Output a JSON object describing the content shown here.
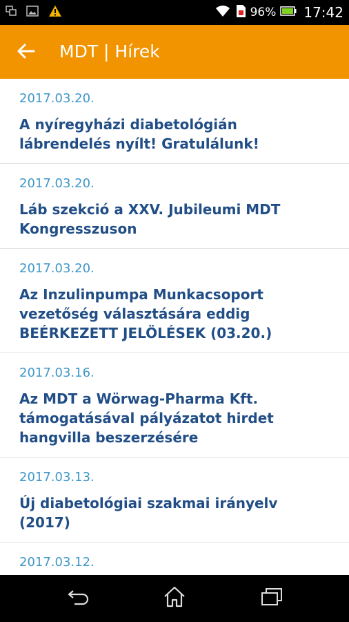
{
  "status_bar": {
    "battery_percent": "96%",
    "time": "17:42",
    "icons": [
      "screenshot-icon",
      "gallery-icon",
      "warning-icon",
      "wifi-icon",
      "sim-icon",
      "battery-icon"
    ]
  },
  "app_bar": {
    "title": "MDT | Hírek",
    "color": "#f29400",
    "back_icon": "arrow-left-icon"
  },
  "news": [
    {
      "date": "2017.03.20.",
      "title": "A nyíregyházi diabetológián lábrendelés nyílt! Gratulálunk!"
    },
    {
      "date": "2017.03.20.",
      "title": "Láb szekció a XXV. Jubileumi MDT Kongresszuson"
    },
    {
      "date": "2017.03.20.",
      "title": "Az Inzulinpumpa Munkacsoport vezetőség választására eddig BEÉRKEZETT JELÖLÉSEK (03.20.)"
    },
    {
      "date": "2017.03.16.",
      "title": "Az MDT a Wörwag-Pharma Kft. támogatásával pályázatot hirdet hangvilla beszerzésére"
    },
    {
      "date": "2017.03.13.",
      "title": "Új diabetológiai szakmai irányelv (2017)"
    },
    {
      "date": "2017.03.12.",
      "title": ""
    }
  ],
  "nav_bar": {
    "icons": [
      "back-nav-icon",
      "home-icon",
      "recent-apps-icon"
    ]
  }
}
